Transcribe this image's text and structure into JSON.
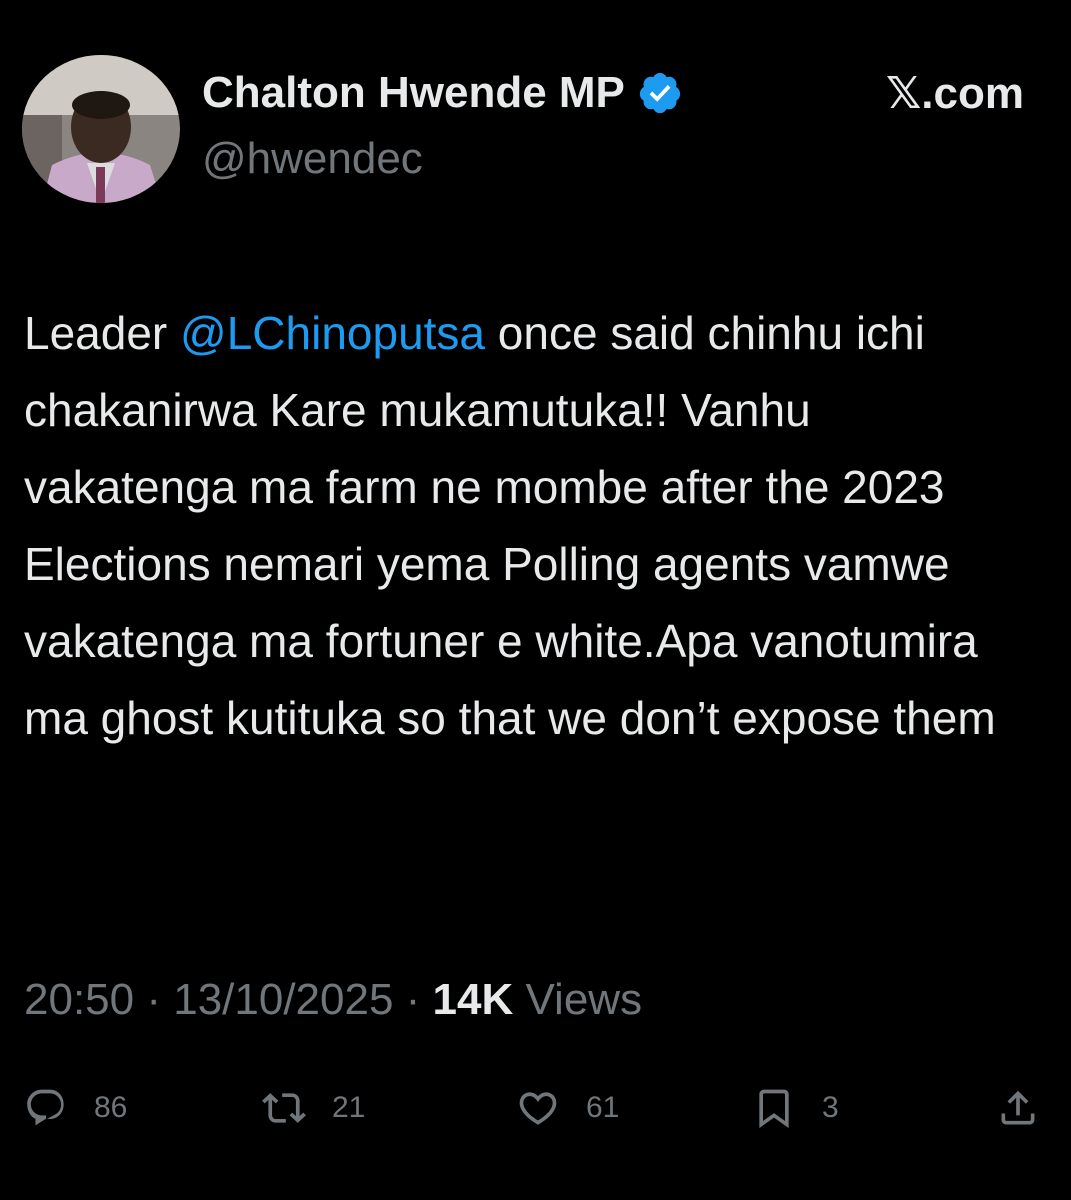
{
  "author": {
    "display_name": "Chalton Hwende MP",
    "handle": "@hwendec",
    "verified": true,
    "avatar_icon": "profile-photo"
  },
  "site_label": "𝕏.com",
  "tweet": {
    "text_before": "Leader ",
    "mention": "@LChinoputsa",
    "text_after": " once said chinhu ichi chakanirwa Kare mukamutuka!! Vanhu vakatenga ma farm ne mombe after the 2023 Elections nemari yema Polling agents vamwe vakatenga ma fortuner e white.Apa vanotumira ma ghost kutituka so that we don’t expose them"
  },
  "meta": {
    "time": "20:50",
    "separator1": " · ",
    "date": "13/10/2025",
    "separator2": " · ",
    "views_count": "14K",
    "views_label": " Views"
  },
  "actions": {
    "replies": "86",
    "reposts": "21",
    "likes": "61",
    "bookmarks": "3"
  },
  "colors": {
    "background": "#000000",
    "text": "#e7e9ea",
    "secondary": "#71767b",
    "accent": "#1d9bf0"
  }
}
